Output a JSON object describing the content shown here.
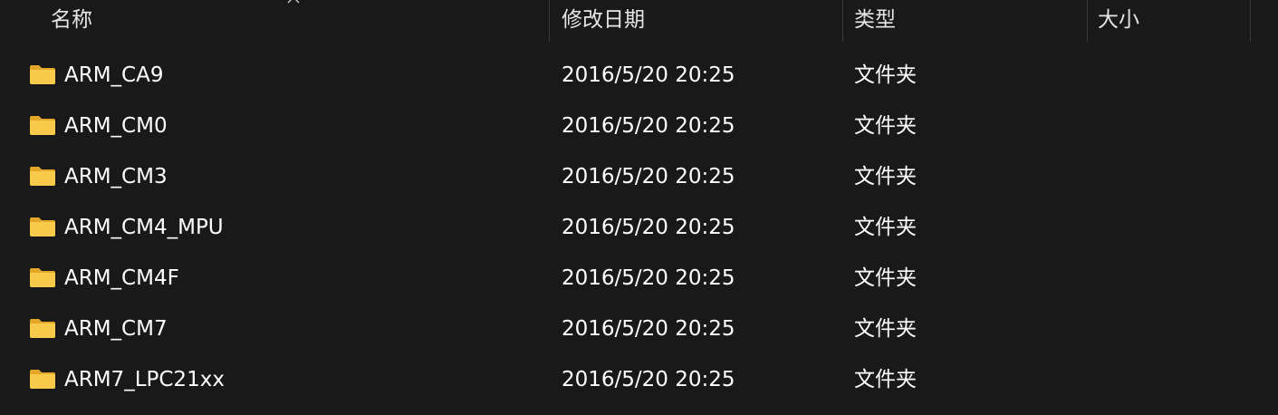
{
  "columns": {
    "name": "名称",
    "date": "修改日期",
    "type": "类型",
    "size": "大小"
  },
  "sort": {
    "column": "name",
    "direction": "ascending",
    "icon": "chevron-up-icon"
  },
  "colors": {
    "background": "#191919",
    "text": "#ffffff",
    "header_text": "#e6e6e6",
    "divider": "#3a3a3a",
    "folder_front": "#f8c94a",
    "folder_back": "#e3a72a"
  },
  "rows": [
    {
      "name": "ARM_CA9",
      "date": "2016/5/20 20:25",
      "type": "文件夹",
      "size": "",
      "icon": "folder-icon"
    },
    {
      "name": "ARM_CM0",
      "date": "2016/5/20 20:25",
      "type": "文件夹",
      "size": "",
      "icon": "folder-icon"
    },
    {
      "name": "ARM_CM3",
      "date": "2016/5/20 20:25",
      "type": "文件夹",
      "size": "",
      "icon": "folder-icon"
    },
    {
      "name": "ARM_CM4_MPU",
      "date": "2016/5/20 20:25",
      "type": "文件夹",
      "size": "",
      "icon": "folder-icon"
    },
    {
      "name": "ARM_CM4F",
      "date": "2016/5/20 20:25",
      "type": "文件夹",
      "size": "",
      "icon": "folder-icon"
    },
    {
      "name": "ARM_CM7",
      "date": "2016/5/20 20:25",
      "type": "文件夹",
      "size": "",
      "icon": "folder-icon"
    },
    {
      "name": "ARM7_LPC21xx",
      "date": "2016/5/20 20:25",
      "type": "文件夹",
      "size": "",
      "icon": "folder-icon"
    }
  ]
}
